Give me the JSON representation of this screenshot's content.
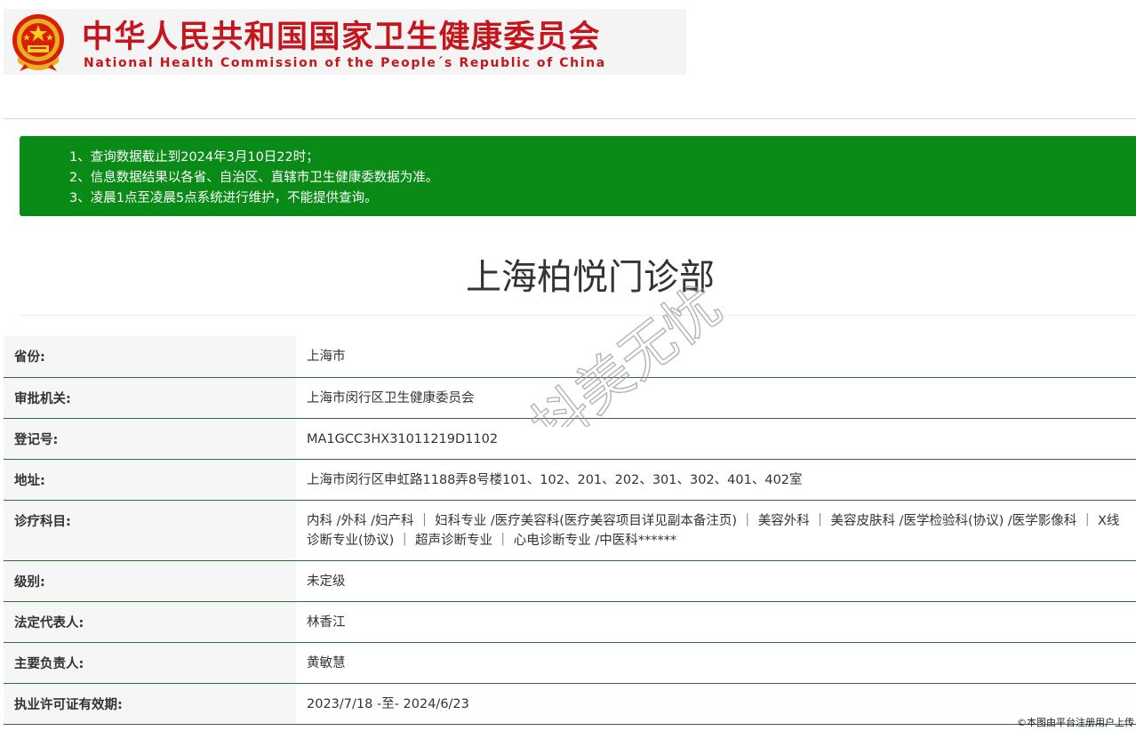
{
  "header": {
    "title_zh": "中华人民共和国国家卫生健康委员会",
    "title_en": "National Health Commission of the People´s Republic of China",
    "brand_color": "#c4161c",
    "emblem_icon": "national-emblem-icon"
  },
  "notice": {
    "background_color": "#0a8a16",
    "lines": [
      "1、查询数据截止到2024年3月10日22时；",
      "2、信息数据结果以各省、自治区、直辖市卫生健康委数据为准。",
      "3、凌晨1点至凌晨5点系统进行维护，不能提供查询。"
    ]
  },
  "page_title": "上海柏悦门诊部",
  "watermark_text": "抖美无忧",
  "rows": [
    {
      "label": "省份:",
      "value": "上海市"
    },
    {
      "label": "审批机关:",
      "value": "上海市闵行区卫生健康委员会"
    },
    {
      "label": "登记号:",
      "value": "MA1GCC3HX31011219D1102"
    },
    {
      "label": "地址:",
      "value": "上海市闵行区申虹路1188弄8号楼101、102、201、202、301、302、401、402室"
    },
    {
      "label": "诊疗科目:",
      "value": "内科 /外科 /妇产科 ｜ 妇科专业 /医疗美容科(医疗美容项目详见副本备注页) ｜ 美容外科 ｜ 美容皮肤科 /医学检验科(协议) /医学影像科 ｜ X线诊断专业(协议) ｜ 超声诊断专业 ｜ 心电诊断专业 /中医科******"
    },
    {
      "label": "级别:",
      "value": "未定级"
    },
    {
      "label": "法定代表人:",
      "value": "林香江"
    },
    {
      "label": "主要负责人:",
      "value": "黄敏慧"
    },
    {
      "label": "执业许可证有效期:",
      "value": "2023/7/18 -至- 2024/6/23"
    }
  ],
  "table_border_color": "#2f6a3d",
  "copyright": "©本图由平台注册用户上传"
}
